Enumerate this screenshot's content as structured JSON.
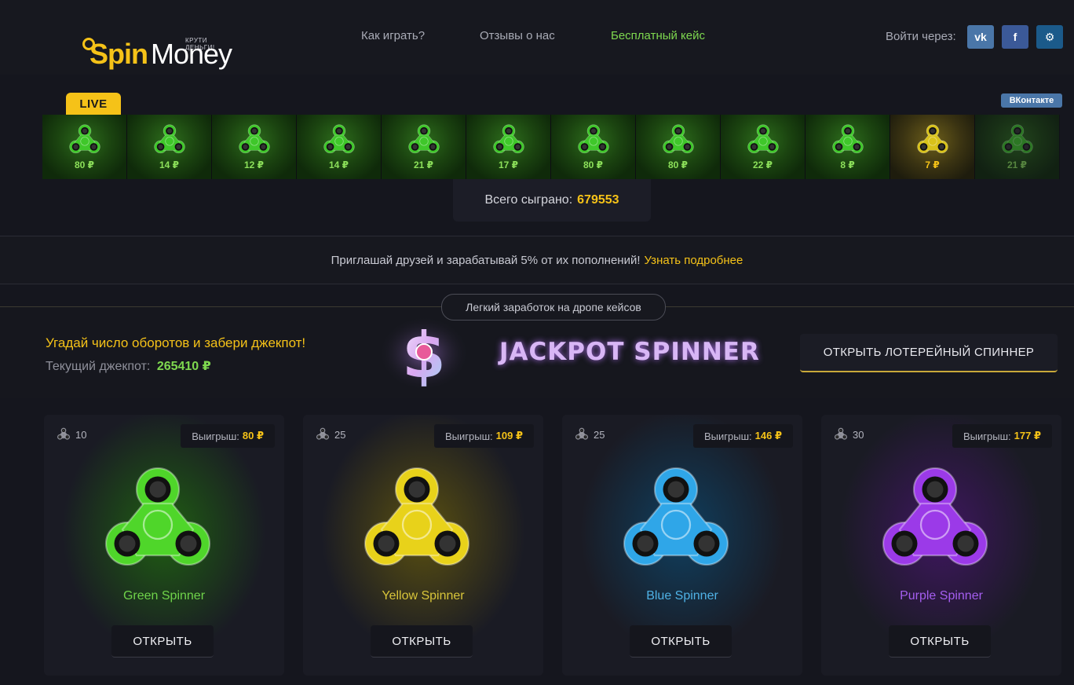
{
  "header": {
    "logo": {
      "slogan": "КРУТИ ДЕНЬГИ!",
      "spin": "Spin",
      "money": "Money"
    },
    "nav": [
      {
        "label": "Как играть?"
      },
      {
        "label": "Отзывы о нас"
      },
      {
        "label": "Бесплатный кейс",
        "active": true
      }
    ],
    "login_label": "Войти через:",
    "social": [
      {
        "icon": "vk-icon",
        "glyph": "vk",
        "color": "#4a76a8"
      },
      {
        "icon": "facebook-icon",
        "glyph": "f",
        "color": "#3b5998"
      },
      {
        "icon": "steam-icon",
        "glyph": "⚙",
        "color": "#1b5a8a"
      }
    ]
  },
  "live": {
    "badge": "LIVE",
    "vk_widget": "ВКонтакте",
    "items": [
      {
        "price": "80 ₽",
        "tone": "green"
      },
      {
        "price": "14 ₽",
        "tone": "green"
      },
      {
        "price": "12 ₽",
        "tone": "green"
      },
      {
        "price": "14 ₽",
        "tone": "green"
      },
      {
        "price": "21 ₽",
        "tone": "green"
      },
      {
        "price": "17 ₽",
        "tone": "green"
      },
      {
        "price": "80 ₽",
        "tone": "green"
      },
      {
        "price": "80 ₽",
        "tone": "green"
      },
      {
        "price": "22 ₽",
        "tone": "green"
      },
      {
        "price": "8 ₽",
        "tone": "green"
      },
      {
        "price": "7 ₽",
        "tone": "gold"
      },
      {
        "price": "21 ₽",
        "tone": "fade"
      }
    ]
  },
  "stats": {
    "label": "Всего сыграно:",
    "value": "679553"
  },
  "referral": {
    "text": "Приглашай друзей и зарабатывай 5% от их пополнений!",
    "link": "Узнать подробнее"
  },
  "jackpot": {
    "pill": "Легкий заработок на дропе кейсов",
    "title": "Угадай число оборотов и забери джекпот!",
    "current_label": "Текущий джекпот:",
    "current_value": "265410 ₽",
    "logo_text": "JACKPOT SPINNER",
    "button": "ОТКРЫТЬ ЛОТЕРЕЙНЫЙ СПИННЕР"
  },
  "cases": [
    {
      "count": "10",
      "win_label": "Выигрыш:",
      "win_value": "80 ₽",
      "name": "Green Spinner",
      "button": "ОТКРЫТЬ",
      "color": "#4fd62a",
      "name_color": "#6fd34a",
      "win_color": "#f5c218",
      "glow": "#1f5f12"
    },
    {
      "count": "25",
      "win_label": "Выигрыш:",
      "win_value": "109 ₽",
      "name": "Yellow Spinner",
      "button": "ОТКРЫТЬ",
      "color": "#e8d21a",
      "name_color": "#d8c53a",
      "win_color": "#f5c218",
      "glow": "#5a5010"
    },
    {
      "count": "25",
      "win_label": "Выигрыш:",
      "win_value": "146 ₽",
      "name": "Blue Spinner",
      "button": "ОТКРЫТЬ",
      "color": "#2fa6e8",
      "name_color": "#4fb2e6",
      "win_color": "#f5c218",
      "glow": "#0f3f5f"
    },
    {
      "count": "30",
      "win_label": "Выигрыш:",
      "win_value": "177 ₽",
      "name": "Purple Spinner",
      "button": "ОТКРЫТЬ",
      "color": "#9b3ae8",
      "name_color": "#a55ef0",
      "win_color": "#f5c218",
      "glow": "#3f1660"
    }
  ]
}
